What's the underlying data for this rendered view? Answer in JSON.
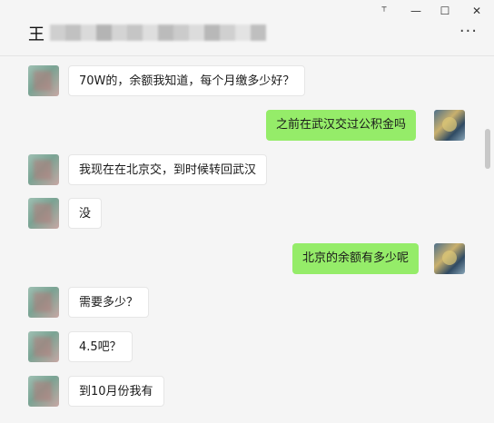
{
  "window": {
    "pin_icon": "pin-icon",
    "minimize_icon": "minimize-icon",
    "maximize_icon": "maximize-icon",
    "close_icon": "close-icon"
  },
  "header": {
    "chat_name": "王",
    "more_label": "···"
  },
  "colors": {
    "self_bubble": "#95ec69",
    "other_bubble": "#ffffff",
    "background": "#f5f5f5"
  },
  "messages": [
    {
      "from": "other",
      "text": "70W的，余额我知道，每个月缴多少好？"
    },
    {
      "from": "self",
      "text": "之前在武汉交过公积金吗"
    },
    {
      "from": "other",
      "text": "我现在在北京交，到时候转回武汉"
    },
    {
      "from": "other",
      "text": "没"
    },
    {
      "from": "self",
      "text": "北京的余额有多少呢"
    },
    {
      "from": "other",
      "text": "需要多少？"
    },
    {
      "from": "other",
      "text": "4.5吧？"
    },
    {
      "from": "other",
      "text": "到10月份我有"
    }
  ]
}
